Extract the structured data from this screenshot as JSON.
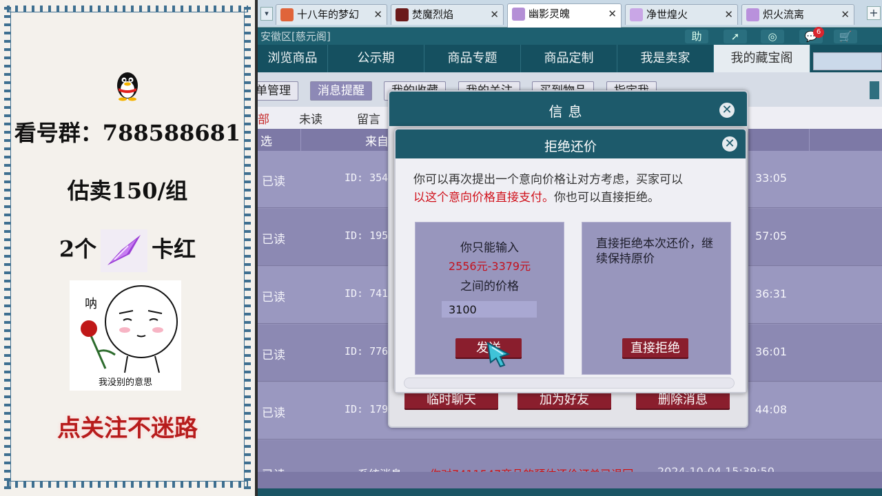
{
  "left_panel": {
    "qq_group": "看号群：788588681",
    "price_note": "估卖150/组",
    "card_prefix": "2个",
    "card_suffix": "卡红",
    "meme_caption": "我没别的意思",
    "meme_bubble": "呐",
    "follow": "点关注不迷路"
  },
  "browser_tabs": [
    {
      "label": "十八年的梦幻",
      "active": false
    },
    {
      "label": "焚魔烈焰",
      "active": false
    },
    {
      "label": "幽影灵魄",
      "active": true
    },
    {
      "label": "净世煌火",
      "active": false
    },
    {
      "label": "炽火流离",
      "active": false
    }
  ],
  "server": {
    "name": "安徽区[慈元阁]",
    "badge": "6"
  },
  "top_icons": [
    "助",
    "➚",
    "◎",
    "💬",
    "🛒"
  ],
  "nav": [
    {
      "label": "浏览商品",
      "active": false
    },
    {
      "label": "公示期",
      "active": false
    },
    {
      "label": "商品专题",
      "active": false
    },
    {
      "label": "商品定制",
      "active": false
    },
    {
      "label": "我是卖家",
      "active": false
    },
    {
      "label": "我的藏宝阁",
      "active": true
    }
  ],
  "subtabs": [
    {
      "label": "单管理",
      "active": false
    },
    {
      "label": "消息提醒",
      "active": true
    },
    {
      "label": "我的收藏",
      "active": false
    },
    {
      "label": "我的关注",
      "active": false
    },
    {
      "label": "买到物品",
      "active": false
    },
    {
      "label": "指定我",
      "active": false
    }
  ],
  "filters": [
    "部",
    "未读",
    "留言"
  ],
  "table": {
    "headers": [
      "选",
      "来自"
    ],
    "rows": [
      {
        "status": "已读",
        "id": "ID: 354",
        "time": "33:05"
      },
      {
        "status": "已读",
        "id": "ID: 195",
        "time": "57:05"
      },
      {
        "status": "已读",
        "id": "ID: 741",
        "time": "36:31"
      },
      {
        "status": "已读",
        "id": "ID: 776",
        "time": "36:01"
      },
      {
        "status": "已读",
        "id": "ID: 179",
        "time": "44:08"
      },
      {
        "status": "已读",
        "source": "系统消息",
        "message": "你对7411547商品的预估还价订单已退回",
        "time": "2024-10-04 15:39:50"
      }
    ]
  },
  "dialog_outer": {
    "title": "信息",
    "buttons": [
      "临时聊天",
      "加为好友",
      "删除消息"
    ]
  },
  "dialog_inner": {
    "title": "拒绝还价",
    "desc_normal": "你可以再次提出一个意向价格让对方考虑，买家可以",
    "desc_red": "以这个意向价格直接支付。",
    "desc_tail": "你也可以直接拒绝。",
    "left_line1": "你只能输入",
    "left_range": "2556元-3379元",
    "left_line3": "之间的价格",
    "input_value": "3100",
    "send_label": "发送",
    "reject_desc": "直接拒绝本次还价，继续保持原价",
    "reject_label": "直接拒绝"
  }
}
